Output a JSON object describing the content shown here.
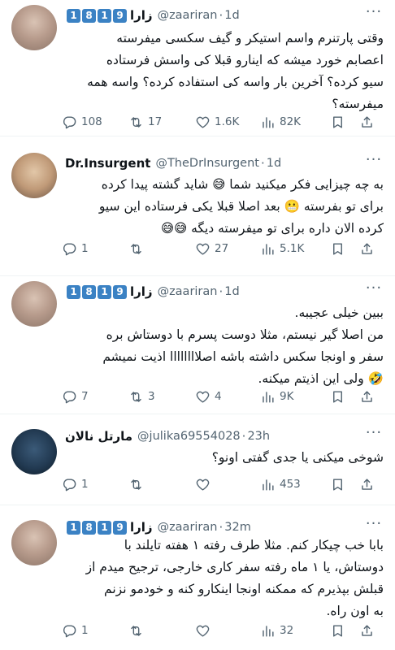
{
  "tweets": [
    {
      "name": "زارا",
      "badges": [
        "1",
        "8",
        "1",
        "9"
      ],
      "handle": "@zaariran",
      "time": "1d",
      "lines": [
        "وقتی پارتنرم واسم استیکر و گیف سکسی میفرسته",
        "اعصابم خورد میشه که اینارو قبلا کی واسش فرستاده",
        "سیو کرده؟ آخرین بار واسه کی استفاده کرده؟ واسه همه",
        "میفرسته؟"
      ],
      "replies": "108",
      "retweets": "17",
      "likes": "1.6K",
      "views": "82K"
    },
    {
      "name": "Dr.Insurgent",
      "handle": "@TheDrInsurgent",
      "time": "1d",
      "lines": [
        "به چه چیزایی فکر میکنید شما 😅 شاید گشته پیدا کرده",
        "برای تو بفرسته 😬 بعد اصلا قبلا یکی فرستاده این سیو",
        "کرده الان داره برای تو میفرسته دیگه 😅😅"
      ],
      "replies": "1",
      "retweets": "",
      "likes": "27",
      "views": "5.1K"
    },
    {
      "name": "زارا",
      "badges": [
        "1",
        "8",
        "1",
        "9"
      ],
      "handle": "@zaariran",
      "time": "1d",
      "lines": [
        "ببین خیلی عجیبه.",
        "من اصلا گیر نیستم، مثلا دوست پسرم با دوستاش بره",
        "سفر و اونجا سکس داشته باشه اصلاااااااا اذیت نمیشم",
        "🤣 ولی این اذیتم میکنه."
      ],
      "replies": "7",
      "retweets": "3",
      "likes": "4",
      "views": "9K"
    },
    {
      "name": "مارتل نالان",
      "handle": "@julika69554028",
      "time": "23h",
      "lines": [
        "شوخی میکنی یا جدی گفتی اونو؟"
      ],
      "replies": "1",
      "retweets": "",
      "likes": "",
      "views": "453"
    },
    {
      "name": "زارا",
      "badges": [
        "1",
        "8",
        "1",
        "9"
      ],
      "handle": "@zaariran",
      "time": "32m",
      "lines": [
        "بابا خب چیکار کنم. مثلا طرف رفته ۱ هفته تایلند با",
        "دوستاش، یا ۱ ماه رفته سفر کاری خارجی، ترجیح میدم از",
        "قبلش بپذیرم که ممکنه اونجا اینکارو کنه و خودمو نزنم",
        "به اون راه."
      ],
      "replies": "1",
      "retweets": "",
      "likes": "",
      "views": "32"
    }
  ],
  "icons": {
    "reply": "reply-icon",
    "retweet": "retweet-icon",
    "like": "heart-icon",
    "views": "views-icon",
    "bookmark": "bookmark-icon",
    "share": "share-icon",
    "more": "more-icon"
  },
  "colors": {
    "badge": "#3b82c4",
    "muted": "#536471",
    "text": "#0f1419"
  }
}
